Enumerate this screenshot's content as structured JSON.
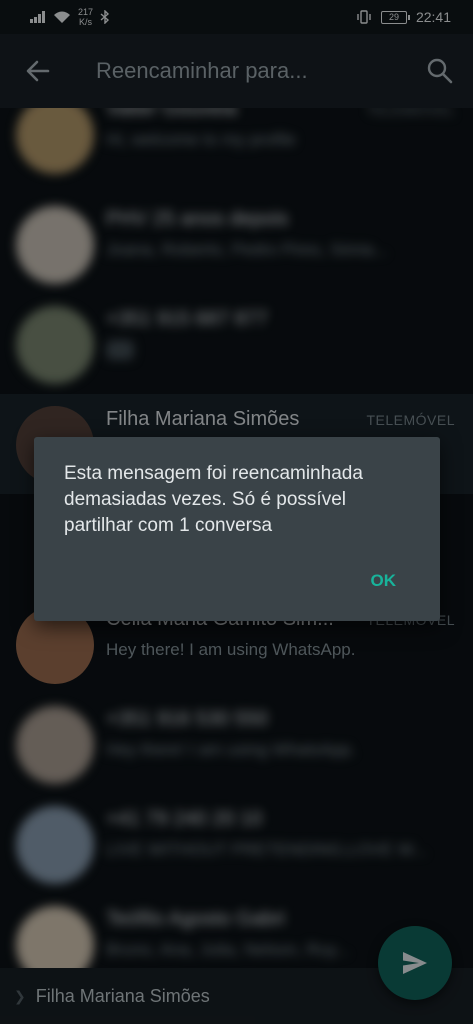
{
  "statusbar": {
    "speed_value": "217",
    "speed_unit": "K/s",
    "battery": "29",
    "time": "22:41"
  },
  "appbar": {
    "title": "Reencaminhar para..."
  },
  "contacts": [
    {
      "name": "Valter Gouveia",
      "status": "Hi, welcome to my profile",
      "tag": "TELEMÓVEL"
    },
    {
      "name": "PHV 25 anos depois",
      "status": "Joana, Roberto, Pedro Pires, Sónia...",
      "tag": ""
    },
    {
      "name": "+351 915 687 877",
      "status": "",
      "tag": ""
    },
    {
      "name": "Filha Mariana Simões",
      "status": "",
      "tag": "TELEMÓVEL"
    },
    {
      "name": "Célia Maria Gamito Sim...",
      "status": "Hey there! I am using WhatsApp.",
      "tag": "TELEMÓVEL"
    },
    {
      "name": "+351 916 530 550",
      "status": "Hey there! I am using WhatsApp.",
      "tag": ""
    },
    {
      "name": "+41 79 240 20 10",
      "status": "LIVE WITHOUT PRETENDING,LOVE W...",
      "tag": ""
    },
    {
      "name": "Teófilo Agosto Gabri",
      "status": "Bruno, Ana, Julia, Nelson, Ruy...",
      "tag": ""
    }
  ],
  "dialog": {
    "message": "Esta mensagem foi reencaminhada demasiadas vezes. Só é possível partilhar com 1 conversa",
    "ok_label": "OK"
  },
  "bottombar": {
    "selected": "Filha Mariana Simões"
  },
  "colors": {
    "accent": "#18b39b",
    "fab": "#0f5a52",
    "dialog_bg": "#3a4348"
  }
}
